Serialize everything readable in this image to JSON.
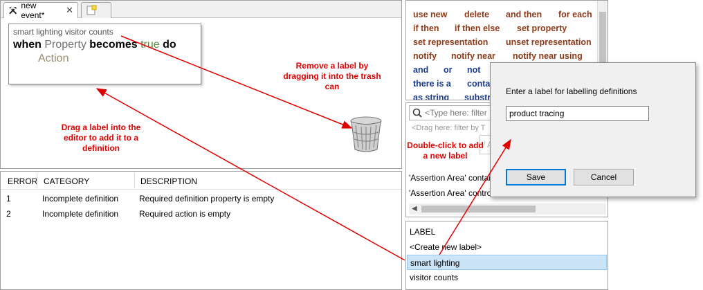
{
  "editor": {
    "tabs": [
      {
        "label": "new event*",
        "close": "✕"
      },
      {
        "label": ""
      }
    ],
    "definition": {
      "labels": "smart lighting visitor counts",
      "when": "when",
      "property": "Property",
      "becomes": "becomes",
      "value": "true",
      "do": "do",
      "action": "Action"
    },
    "annotations": {
      "remove": "Remove a label by dragging it into the trash can",
      "drag": "Drag a label into the editor to add it to a definition",
      "double_click": "Double-click to add a new label"
    }
  },
  "problems": {
    "columns": [
      "ERROR",
      "CATEGORY",
      "DESCRIPTION"
    ],
    "rows": [
      [
        "1",
        "Incomplete definition",
        "Required definition property is empty"
      ],
      [
        "2",
        "Incomplete definition",
        "Required action is empty"
      ]
    ]
  },
  "palette": {
    "items": [
      {
        "label": "use new",
        "color": "#8b3a1a"
      },
      {
        "label": "delete",
        "color": "#8b3a1a"
      },
      {
        "label": "and then",
        "color": "#8b3a1a"
      },
      {
        "label": "for each",
        "color": "#8b3a1a"
      },
      {
        "label": "if then",
        "color": "#8b3a1a"
      },
      {
        "label": "if then else",
        "color": "#8b3a1a"
      },
      {
        "label": "set property",
        "color": "#8b3a1a"
      },
      {
        "label": "set representation",
        "color": "#8b3a1a"
      },
      {
        "label": "unset representation",
        "color": "#8b3a1a"
      },
      {
        "label": "notify",
        "color": "#8b3a1a"
      },
      {
        "label": "notify near",
        "color": "#8b3a1a"
      },
      {
        "label": "notify near using",
        "color": "#8b3a1a"
      },
      {
        "label": "and",
        "color": "#1a3a8a"
      },
      {
        "label": "or",
        "color": "#1a3a8a"
      },
      {
        "label": "not",
        "color": "#1a3a8a"
      },
      {
        "label": "there is a",
        "color": "#1a3a8a"
      },
      {
        "label": "conta",
        "color": "#1a3a8a"
      },
      {
        "label": "as string",
        "color": "#1a3a8a"
      },
      {
        "label": "substri",
        "color": "#1a3a8a"
      }
    ]
  },
  "filter": {
    "search_placeholder": "<Type here: filter",
    "drag_filter": "<Drag here: filter by T",
    "field_text": "/ A",
    "lines": [
      "'Assertion Area' contai",
      "'Assertion Area' contro"
    ]
  },
  "labels": {
    "header": "LABEL",
    "items": [
      "<Create new label>",
      "smart lighting",
      "visitor counts"
    ],
    "selected": "smart lighting"
  },
  "dialog": {
    "prompt": "Enter a label for labelling definitions",
    "input_value": "product tracing",
    "save": "Save",
    "cancel": "Cancel"
  },
  "colors": {
    "annotation": "#e00000",
    "selection": "#cce4f7",
    "action_keyword": "#8b3a1a",
    "logic_keyword": "#1a3a8a"
  }
}
